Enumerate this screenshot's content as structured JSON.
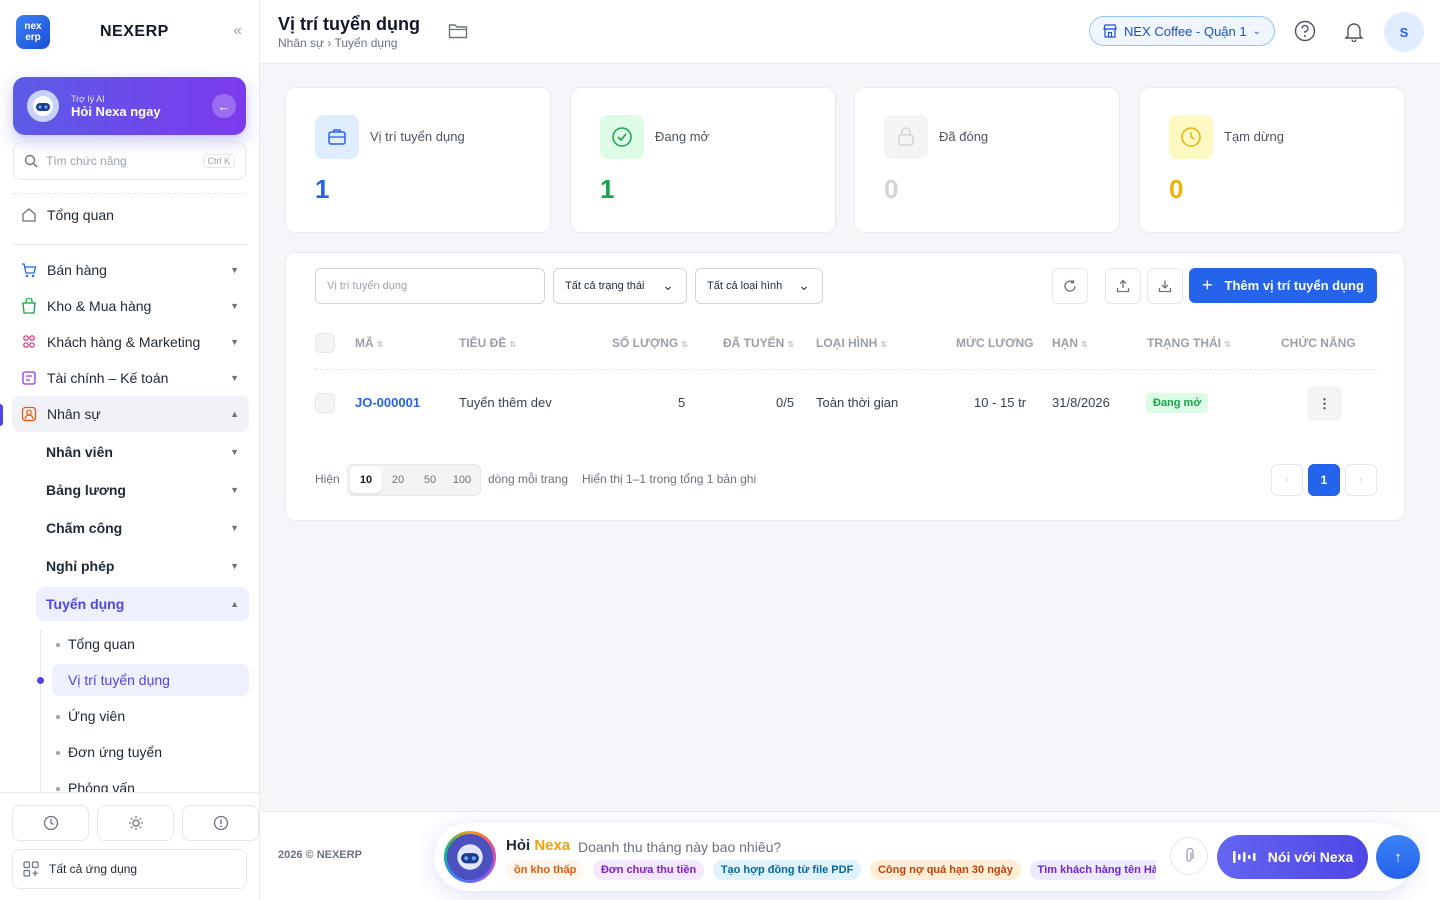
{
  "brand": {
    "logo_text": "nex erp",
    "name": "NEXERP"
  },
  "ai_card": {
    "sub": "Trợ lý AI",
    "main": "Hỏi Nexa ngay"
  },
  "search": {
    "placeholder": "Tìm chức năng",
    "shortcut": "Ctrl K"
  },
  "sidebar": {
    "overview": "Tổng quan",
    "groups": [
      "Bán hàng",
      "Kho & Mua hàng",
      "Khách hàng & Marketing",
      "Tài chính – Kế toán",
      "Nhân sự"
    ],
    "hr_items": [
      "Nhân viên",
      "Bảng lương",
      "Chấm công",
      "Nghỉ phép",
      "Tuyển dụng"
    ],
    "recruit_items": [
      "Tổng quan",
      "Vị trí tuyển dụng",
      "Ứng viên",
      "Đơn ứng tuyển",
      "Phỏng vấn"
    ],
    "all_apps": "Tất cả ứng dụng"
  },
  "header": {
    "title": "Vị trí tuyển dụng",
    "breadcrumb": "Nhân sự › Tuyển dụng",
    "store": "NEX Coffee - Quận 1",
    "avatar": "S"
  },
  "stats": [
    {
      "label": "Vị trí tuyển dụng",
      "value": "1",
      "color": "#2563eb"
    },
    {
      "label": "Đang mở",
      "value": "1",
      "color": "#16a34a"
    },
    {
      "label": "Đã đóng",
      "value": "0",
      "color": "#d1d5db"
    },
    {
      "label": "Tạm dừng",
      "value": "0",
      "color": "#eab308"
    }
  ],
  "filters": {
    "search_placeholder": "Vị trí tuyển dụng",
    "status": "Tất cả trạng thái",
    "type": "Tất cả loại hình",
    "add_button": "Thêm vị trí tuyển dụng"
  },
  "table": {
    "headers": [
      "Mã",
      "Tiêu đề",
      "Số lượng",
      "Đã tuyển",
      "Loại hình",
      "Mức lương",
      "Hạn",
      "Trạng thái",
      "Chức năng"
    ],
    "rows": [
      {
        "code": "JO-000001",
        "title": "Tuyển thêm dev",
        "quantity": "5",
        "hired": "0/5",
        "type": "Toàn thời gian",
        "salary": "10 - 15 tr",
        "deadline": "31/8/2026",
        "status": "Đang mở"
      }
    ]
  },
  "pagination": {
    "show": "Hiện",
    "sizes": [
      "10",
      "20",
      "50",
      "100"
    ],
    "per_page": "dòng mỗi trang",
    "summary": "Hiển thị 1–1 trong tổng 1 bản ghi",
    "current": "1"
  },
  "footer": {
    "copyright": "2026 © NEXERP"
  },
  "chat": {
    "title_prefix": "Hỏi",
    "title_name": "Nexa",
    "placeholder": "Doanh thu tháng này bao nhiêu?",
    "chips": [
      "ồn kho thấp",
      "Đơn chưa thu tiền",
      "Tạo hợp đồng từ file PDF",
      "Công nợ quá hạn 30 ngày",
      "Tìm khách hàng tên Hà"
    ],
    "voice": "Nói với Nexa"
  }
}
